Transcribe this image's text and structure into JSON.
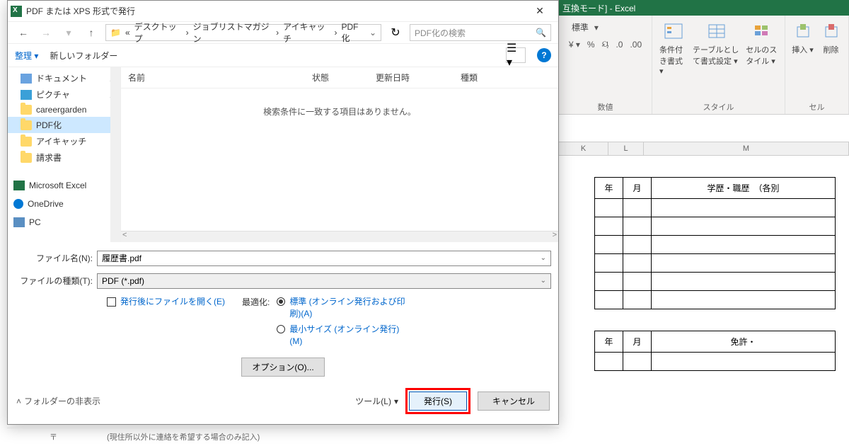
{
  "excel": {
    "title_suffix": "互換モード]  -  Excel",
    "format_label": "標準",
    "group_number": "数値",
    "group_style": "スタイル",
    "group_cell": "セル",
    "btn_cond": "条件付き書式 ▾",
    "btn_table": "テーブルとして書式設定 ▾",
    "btn_cell": "セルのスタイル ▾",
    "btn_insert": "挿入 ▾",
    "btn_delete": "削除",
    "cols": [
      "K",
      "L",
      "M"
    ],
    "table1": {
      "h_year": "年",
      "h_month": "月",
      "h_title": "学歴・職歴　（各別"
    },
    "table2": {
      "h_year": "年",
      "h_month": "月",
      "h_title": "免許・"
    }
  },
  "dialog": {
    "title": "PDF または XPS 形式で発行",
    "breadcrumb": [
      "«",
      "デスクトップ",
      "ジョブリストマガジン",
      "アイキャッチ",
      "PDF化"
    ],
    "search_placeholder": "PDF化の検索",
    "organize": "整理 ▾",
    "new_folder": "新しいフォルダー",
    "tree": [
      {
        "icon": "doc",
        "label": "ドキュメント",
        "pin": true
      },
      {
        "icon": "pic",
        "label": "ピクチャ",
        "pin": true
      },
      {
        "icon": "folder",
        "label": "careergarden"
      },
      {
        "icon": "folder",
        "label": "PDF化",
        "selected": true
      },
      {
        "icon": "folder",
        "label": "アイキャッチ"
      },
      {
        "icon": "folder",
        "label": "請求書"
      },
      {
        "icon": "excel",
        "label": "Microsoft Excel"
      },
      {
        "icon": "onedrive",
        "label": "OneDrive"
      },
      {
        "icon": "pc",
        "label": "PC"
      }
    ],
    "list_headers": {
      "name": "名前",
      "status": "状態",
      "date": "更新日時",
      "type": "種類"
    },
    "empty_msg": "検索条件に一致する項目はありません。",
    "filename_label": "ファイル名(N):",
    "filename_value": "履歴書.pdf",
    "filetype_label": "ファイルの種類(T):",
    "filetype_value": "PDF (*.pdf)",
    "open_after": "発行後にファイルを開く(E)",
    "optimize_label": "最適化:",
    "opt_standard": "標準 (オンライン発行および印刷)(A)",
    "opt_min": "最小サイズ (オンライン発行)(M)",
    "options_btn": "オプション(O)...",
    "hide_folders": "フォルダーの非表示",
    "tools": "ツール(L)",
    "publish": "発行(S)",
    "cancel": "キャンセル"
  },
  "bottom": {
    "mark": "〒",
    "note": "(現住所以外に連絡を希望する場合のみ記入)"
  }
}
